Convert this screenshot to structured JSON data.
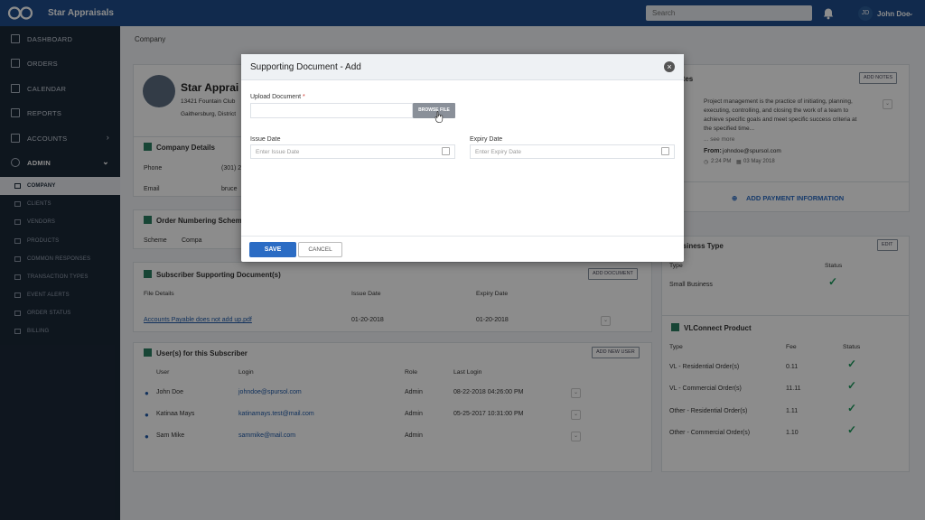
{
  "header": {
    "brand": "Star Appraisals",
    "search_placeholder": "Search",
    "avatar_initials": "JD",
    "user_name": "John Doe"
  },
  "sidebar": {
    "items": [
      {
        "label": "DASHBOARD"
      },
      {
        "label": "ORDERS"
      },
      {
        "label": "CALENDAR"
      },
      {
        "label": "REPORTS"
      },
      {
        "label": "ACCOUNTS"
      },
      {
        "label": "ADMIN"
      }
    ],
    "subitems": [
      {
        "label": "COMPANY"
      },
      {
        "label": "CLIENTS"
      },
      {
        "label": "VENDORS"
      },
      {
        "label": "PRODUCTS"
      },
      {
        "label": "COMMON RESPONSES"
      },
      {
        "label": "TRANSACTION TYPES"
      },
      {
        "label": "EVENT ALERTS"
      },
      {
        "label": "ORDER STATUS"
      },
      {
        "label": "BILLING"
      }
    ]
  },
  "main": {
    "breadcrumb": "Company",
    "company": {
      "name": "Star Apprai",
      "address1": "13421 Fountain Club",
      "address2": "Gaithersburg, District"
    },
    "details": {
      "title": "Company Details",
      "phone_label": "Phone",
      "phone_value": "(301) 2",
      "email_label": "Email",
      "email_value": "bruce"
    },
    "numbering": {
      "title": "Order Numbering Scheme",
      "scheme_label": "Scheme",
      "scheme_value": "Compa"
    },
    "documents": {
      "title": "Subscriber Supporting Document(s)",
      "add_label": "ADD DOCUMENT",
      "columns": [
        "File Details",
        "Issue Date",
        "Expiry Date"
      ],
      "rows": [
        {
          "file": "Accounts Payable does not add up.pdf",
          "issue": "01-20-2018",
          "expiry": "01-20-2018"
        }
      ]
    },
    "users": {
      "title": "User(s) for this Subscriber",
      "add_label": "ADD NEW USER",
      "columns": [
        "User",
        "Login",
        "Role",
        "Last Login"
      ],
      "rows": [
        {
          "user": "John Doe",
          "login": "johndoe@spursol.com",
          "role": "Admin",
          "last": "08-22-2018 04:26:00 PM"
        },
        {
          "user": "Katinaa Mays",
          "login": "katinamays.test@mail.com",
          "role": "Admin",
          "last": "05-25-2017 10:31:00 PM"
        },
        {
          "user": "Sam Mike",
          "login": "sammike@mail.com",
          "role": "Admin",
          "last": ""
        }
      ]
    },
    "notes": {
      "title": "Notes",
      "add_label": "ADD NOTES",
      "text": "Project management is the practice of initiating, planning, executing, controlling, and closing the work of a team to achieve specific goals and meet specific success criteria at the specified time...",
      "see_more": "... see more",
      "from_label": "From:",
      "from": "johndoe@spursol.com",
      "time": "2:24 PM",
      "date": "03 May 2018"
    },
    "payment": {
      "label": "ADD PAYMENT INFORMATION"
    },
    "business": {
      "title": "Business Type",
      "edit_label": "EDIT",
      "col_type": "Type",
      "col_status": "Status",
      "row_type": "Small Business"
    },
    "product": {
      "title": "VLConnect Product",
      "columns": [
        "Type",
        "Fee",
        "Status"
      ],
      "rows": [
        {
          "type": "VL - Residential Order(s)",
          "fee": "0.11"
        },
        {
          "type": "VL - Commercial Order(s)",
          "fee": "11.11"
        },
        {
          "type": "Other - Residential Order(s)",
          "fee": "1.11"
        },
        {
          "type": "Other - Commercial Order(s)",
          "fee": "1.10"
        }
      ]
    }
  },
  "modal": {
    "title": "Supporting Document - Add",
    "upload_label": "Upload Document",
    "required_mark": "*",
    "browse_label": "BROWSE FILE",
    "issue_label": "Issue Date",
    "issue_placeholder": "Enter Issue Date",
    "expiry_label": "Expiry Date",
    "expiry_placeholder": "Enter Expiry Date",
    "save_label": "SAVE",
    "cancel_label": "CANCEL"
  },
  "colors": {
    "topbar": "#1f4e8c",
    "sidebar": "#1b2838",
    "accent": "#2b6cc4",
    "check": "#1a9a5c"
  }
}
